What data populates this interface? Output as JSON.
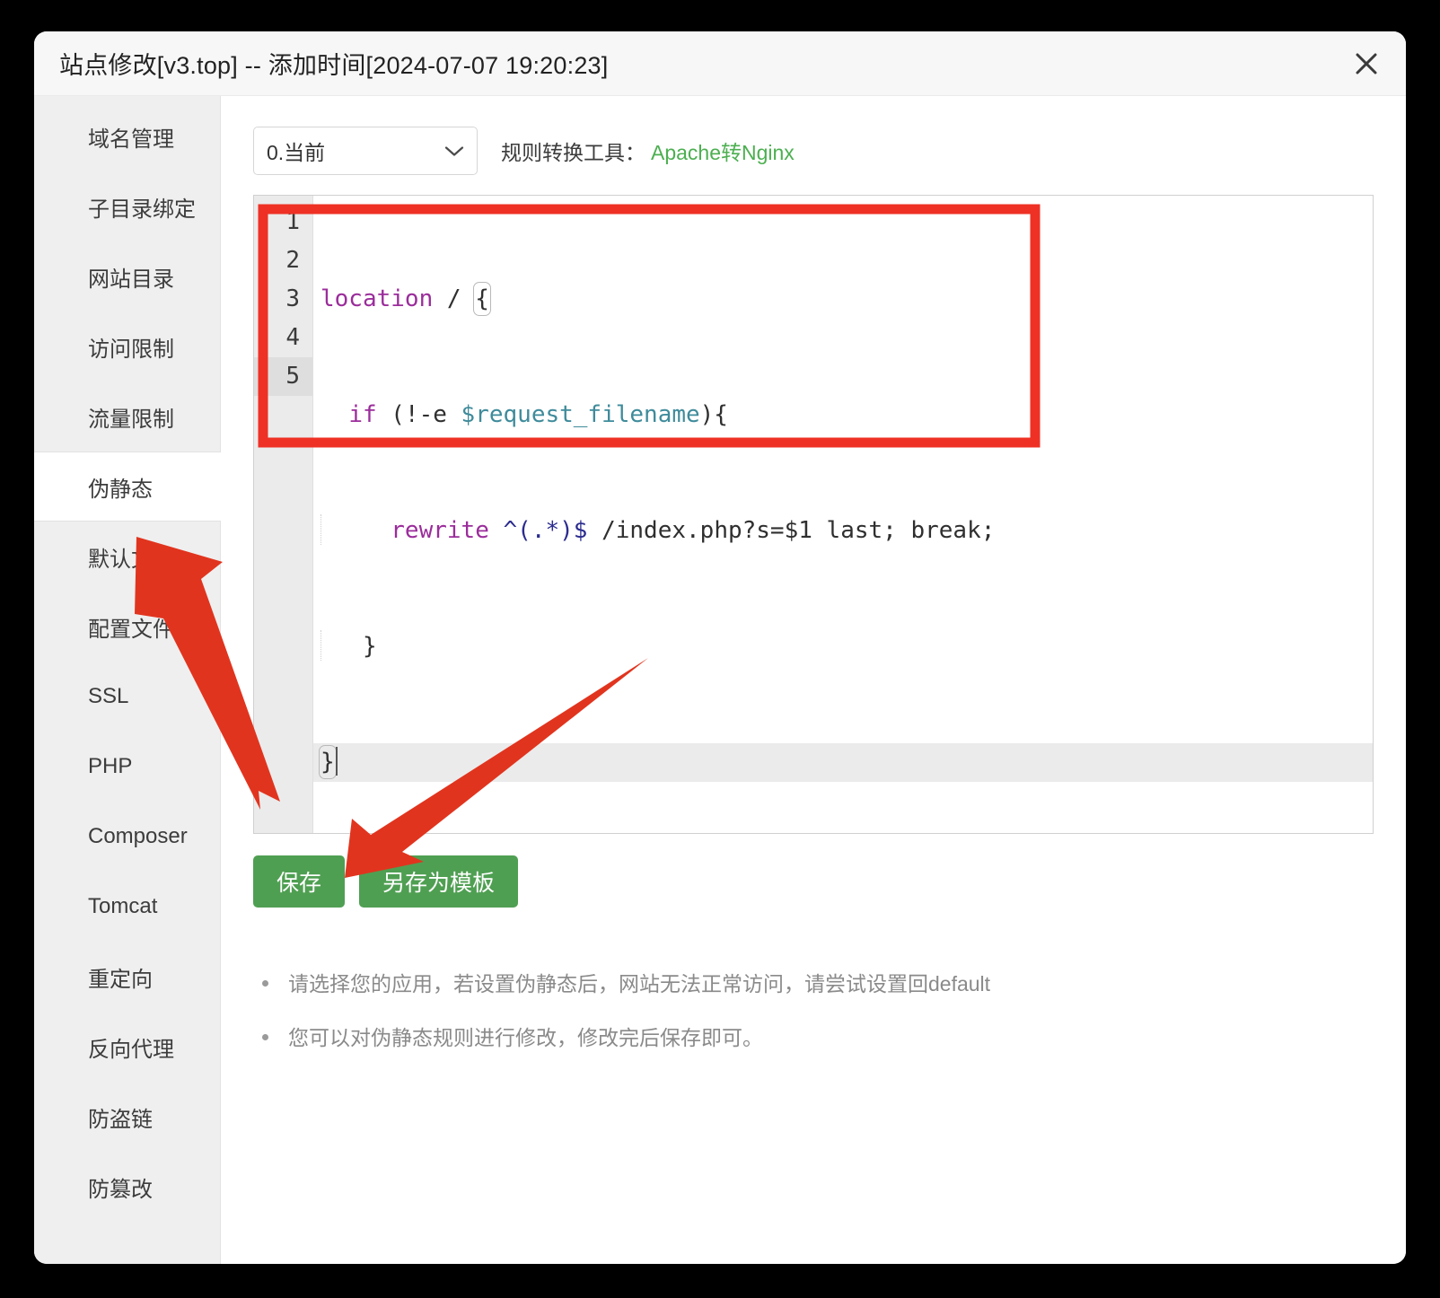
{
  "window": {
    "title": "站点修改[v3.top] -- 添加时间[2024-07-07 19:20:23]",
    "close_icon": "close-icon"
  },
  "sidebar": {
    "items": [
      {
        "label": "域名管理",
        "active": false
      },
      {
        "label": "子目录绑定",
        "active": false
      },
      {
        "label": "网站目录",
        "active": false
      },
      {
        "label": "访问限制",
        "active": false
      },
      {
        "label": "流量限制",
        "active": false
      },
      {
        "label": "伪静态",
        "active": true
      },
      {
        "label": "默认文档",
        "active": false
      },
      {
        "label": "配置文件",
        "active": false
      },
      {
        "label": "SSL",
        "active": false
      },
      {
        "label": "PHP",
        "active": false
      },
      {
        "label": "Composer",
        "active": false
      },
      {
        "label": "Tomcat",
        "active": false
      },
      {
        "label": "重定向",
        "active": false
      },
      {
        "label": "反向代理",
        "active": false
      },
      {
        "label": "防盗链",
        "active": false
      },
      {
        "label": "防篡改",
        "active": false
      }
    ]
  },
  "toolbar": {
    "template_select_value": "0.当前",
    "template_select_options": [
      "0.当前"
    ],
    "chevron_icon": "chevron-down-icon",
    "convert_label": "规则转换工具：",
    "convert_link": "Apache转Nginx",
    "convert_link_color": "#4caf50"
  },
  "editor": {
    "line_numbers": [
      "1",
      "2",
      "3",
      "4",
      "5"
    ],
    "active_line": 5,
    "lines": [
      {
        "n": "1",
        "text": "location / {"
      },
      {
        "n": "2",
        "text": "  if (!-e $request_filename){"
      },
      {
        "n": "3",
        "text": "      rewrite ^(.*)$ /index.php?s=$1 last; break;"
      },
      {
        "n": "4",
        "text": "    }"
      },
      {
        "n": "5",
        "text": "}"
      }
    ],
    "tokens": {
      "line1_keyword": "location",
      "line1_path": " / ",
      "line1_brace": "{",
      "line2_keyword": "if",
      "line2_open": " (!-e ",
      "line2_var": "$request_filename",
      "line2_close": "){",
      "line3_keyword": "rewrite",
      "line3_regex": " ^(.*)$",
      "line3_rest": " /index.php?s=$1 last; break;",
      "line4_brace": "}",
      "line5_brace": "}"
    }
  },
  "buttons": {
    "save": "保存",
    "save_as_template": "另存为模板",
    "color": "#4f9f52"
  },
  "tips": [
    "请选择您的应用，若设置伪静态后，网站无法正常访问，请尝试设置回default",
    "您可以对伪静态规则进行修改，修改完后保存即可。"
  ],
  "annotations": {
    "highlight_box_color": "#ee3124",
    "arrow_color": "#e1341e",
    "arrow_1_target": "伪静态",
    "arrow_2_target": "保存"
  }
}
